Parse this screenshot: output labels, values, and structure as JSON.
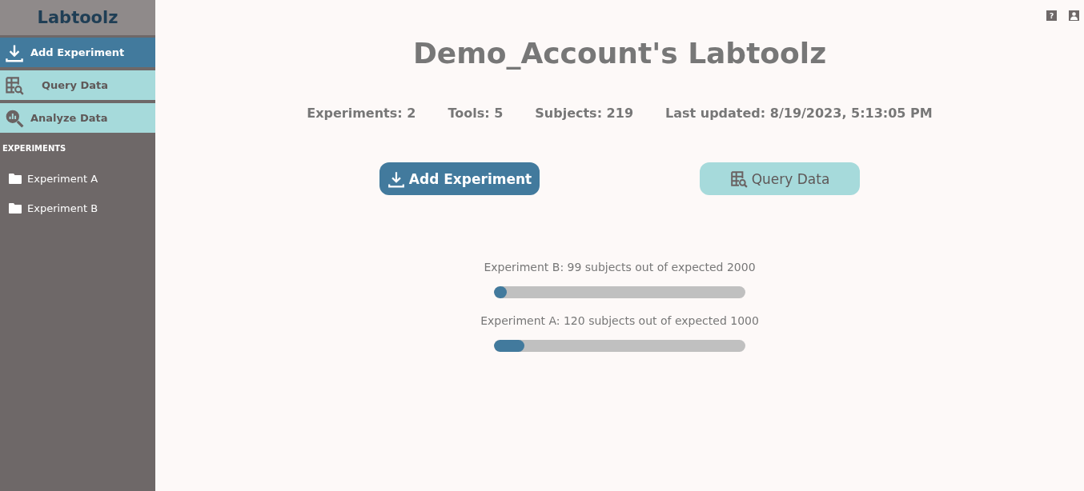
{
  "sidebar": {
    "brand": "Labtoolz",
    "nav": [
      {
        "label": "Add Experiment",
        "kind": "add"
      },
      {
        "label": "Query Data",
        "kind": "query"
      },
      {
        "label": "Analyze Data",
        "kind": "analyze"
      }
    ],
    "section_title": "EXPERIMENTS",
    "items": [
      {
        "label": "Experiment A"
      },
      {
        "label": "Experiment B"
      }
    ]
  },
  "top_icons": {
    "help": "?"
  },
  "title": "Demo_Account's Labtoolz",
  "stats": [
    "Experiments: 2",
    "Tools: 5",
    "Subjects: 219",
    "Last updated: 8/19/2023, 5:13:05 PM"
  ],
  "actions": [
    {
      "label": "Add Experiment",
      "kind": "add"
    },
    {
      "label": "Query Data",
      "kind": "query"
    }
  ],
  "progress": [
    {
      "label": "Experiment B: 99 subjects out of expected 2000",
      "level": 0.05
    },
    {
      "label": "Experiment A: 120 subjects out of expected 1000",
      "level": 0.12
    }
  ]
}
